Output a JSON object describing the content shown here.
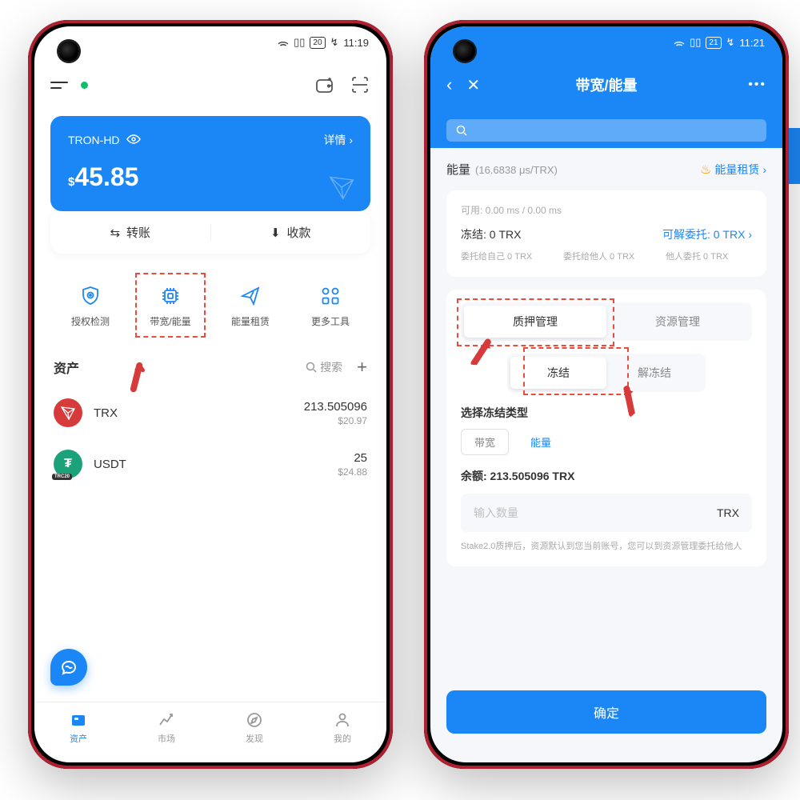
{
  "blue_tab_visible": true,
  "phone1": {
    "status": {
      "battery": "20",
      "time": "11:19"
    },
    "wallet": {
      "name": "TRON-HD",
      "detail": "详情",
      "currency": "$",
      "balance": "45.85"
    },
    "actions": {
      "transfer": "转账",
      "receive": "收款"
    },
    "tools": [
      {
        "label": "授权检测",
        "icon": "shield-icon"
      },
      {
        "label": "带宽/能量",
        "icon": "chip-icon",
        "highlight": true
      },
      {
        "label": "能量租赁",
        "icon": "send-icon"
      },
      {
        "label": "更多工具",
        "icon": "grid-icon"
      }
    ],
    "assets": {
      "title": "资产",
      "search": "搜索",
      "add": "+"
    },
    "asset_list": [
      {
        "symbol": "TRX",
        "amount": "213.505096",
        "usd": "$20.97"
      },
      {
        "symbol": "USDT",
        "amount": "25",
        "usd": "$24.88"
      }
    ],
    "nav": [
      {
        "label": "资产",
        "active": true
      },
      {
        "label": "市场"
      },
      {
        "label": "发现"
      },
      {
        "label": "我的"
      }
    ]
  },
  "phone2": {
    "status": {
      "battery": "21",
      "time": "11:21"
    },
    "header": {
      "title": "带宽/能量"
    },
    "energy": {
      "label": "能量",
      "rate": "(16.6838 μs/TRX)",
      "lease": "能量租赁"
    },
    "card": {
      "available": "可用: 0.00 ms / 0.00 ms",
      "frozen": "冻结: 0 TRX",
      "delegatable": "可解委托: 0 TRX",
      "del_self": "委托给自己 0 TRX",
      "del_other": "委托给他人 0 TRX",
      "other_del": "他人委托 0 TRX"
    },
    "seg1": {
      "opt1": "质押管理",
      "opt2": "资源管理"
    },
    "seg2": {
      "opt1": "冻结",
      "opt2": "解冻结"
    },
    "freeze_type": {
      "label": "选择冻结类型",
      "opt1": "带宽",
      "opt2": "能量"
    },
    "balance": {
      "label": "余额: 213.505096 TRX"
    },
    "input": {
      "placeholder": "输入数量",
      "unit": "TRX"
    },
    "hint": "Stake2.0质押后，资源默认到您当前账号，您可以到资源管理委托给他人",
    "confirm": "确定"
  }
}
